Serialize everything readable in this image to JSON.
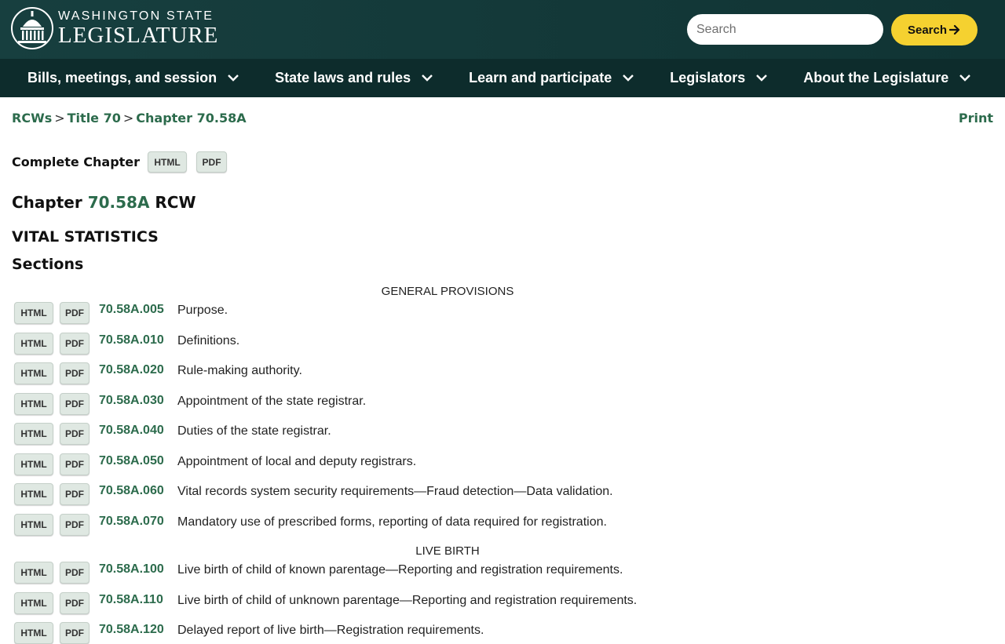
{
  "header": {
    "logo_line1": "WASHINGTON STATE",
    "logo_line2": "LEGISLATURE",
    "search_placeholder": "Search",
    "search_button": "Search"
  },
  "nav": {
    "items": [
      {
        "label": "Bills, meetings, and session"
      },
      {
        "label": "State laws and rules"
      },
      {
        "label": "Learn and participate"
      },
      {
        "label": "Legislators"
      },
      {
        "label": "About the Legislature"
      }
    ]
  },
  "breadcrumb": {
    "items": [
      "RCWs",
      "Title 70",
      "Chapter 70.58A"
    ],
    "separator": ">"
  },
  "print_label": "Print",
  "complete_chapter": {
    "label": "Complete Chapter",
    "html": "HTML",
    "pdf": "PDF"
  },
  "chapter": {
    "prefix": "Chapter",
    "number": "70.58A",
    "suffix": "RCW",
    "title": "VITAL STATISTICS",
    "sections_label": "Sections"
  },
  "groups": [
    {
      "title": "GENERAL PROVISIONS"
    },
    {
      "title": "LIVE BIRTH"
    }
  ],
  "sections": [
    {
      "num": "70.58A.005",
      "title": "Purpose."
    },
    {
      "num": "70.58A.010",
      "title": "Definitions."
    },
    {
      "num": "70.58A.020",
      "title": "Rule-making authority."
    },
    {
      "num": "70.58A.030",
      "title": "Appointment of the state registrar."
    },
    {
      "num": "70.58A.040",
      "title": "Duties of the state registrar."
    },
    {
      "num": "70.58A.050",
      "title": "Appointment of local and deputy registrars."
    },
    {
      "num": "70.58A.060",
      "title": "Vital records system security requirements—Fraud detection—Data validation."
    },
    {
      "num": "70.58A.070",
      "title": "Mandatory use of prescribed forms, reporting of data required for registration."
    },
    {
      "num": "70.58A.100",
      "title": "Live birth of child of known parentage—Reporting and registration requirements."
    },
    {
      "num": "70.58A.110",
      "title": "Live birth of child of unknown parentage—Reporting and registration requirements."
    },
    {
      "num": "70.58A.120",
      "title": "Delayed report of live birth—Registration requirements."
    }
  ],
  "button_labels": {
    "html": "HTML",
    "pdf": "PDF"
  },
  "colors": {
    "header_bg": "#163d3d",
    "nav_bg": "#0d2c2c",
    "accent_green": "#2c6b4c",
    "search_yellow": "#f5d130"
  }
}
